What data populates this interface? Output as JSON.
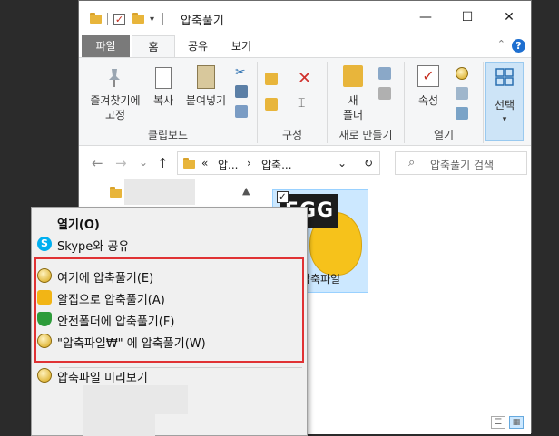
{
  "window": {
    "title": "압축풀기",
    "controls": {
      "minimize": "—",
      "maximize": "☐",
      "close": "✕"
    }
  },
  "ribbon_tabs": [
    {
      "label": "파일"
    },
    {
      "label": "홈"
    },
    {
      "label": "공유"
    },
    {
      "label": "보기"
    }
  ],
  "ribbon_groups": {
    "clipboard": {
      "label": "클립보드",
      "pin_label_1": "즐겨찾기에",
      "pin_label_2": "고정",
      "copy": "복사",
      "paste": "붙여넣기"
    },
    "organize": {
      "label": "구성"
    },
    "new": {
      "label": "새로 만들기",
      "new_folder_1": "새",
      "new_folder_2": "폴더"
    },
    "open": {
      "label": "열기",
      "properties": "속성"
    },
    "select": {
      "label": "선택"
    }
  },
  "nav": {
    "back": "←",
    "forward": "→",
    "recent": "⌄",
    "up": "↑",
    "path_prefix": "«",
    "crumb_1": "압...",
    "crumb_sep": "›",
    "crumb_2": "압축...",
    "dropdown": "⌄",
    "refresh": "↻",
    "search_placeholder": "압축풀기 검색"
  },
  "file": {
    "name": "압축파일",
    "icon_text": "EGG",
    "checked": "✓"
  },
  "context_menu": {
    "open": "열기(O)",
    "skype_share": "Skype와 공유",
    "extract_here": "여기에 압축풀기(E)",
    "alzip_extract": "알집으로 압축풀기(A)",
    "safe_extract": "안전폴더에 압축풀기(F)",
    "extract_to_named": "\"압축파일₩\" 에 압축풀기(W)",
    "preview": "압축파일 미리보기"
  },
  "colors": {
    "highlight_border": "#e03234",
    "selected_tile": "#cce8ff",
    "egg_yellow": "#f6c21b"
  }
}
